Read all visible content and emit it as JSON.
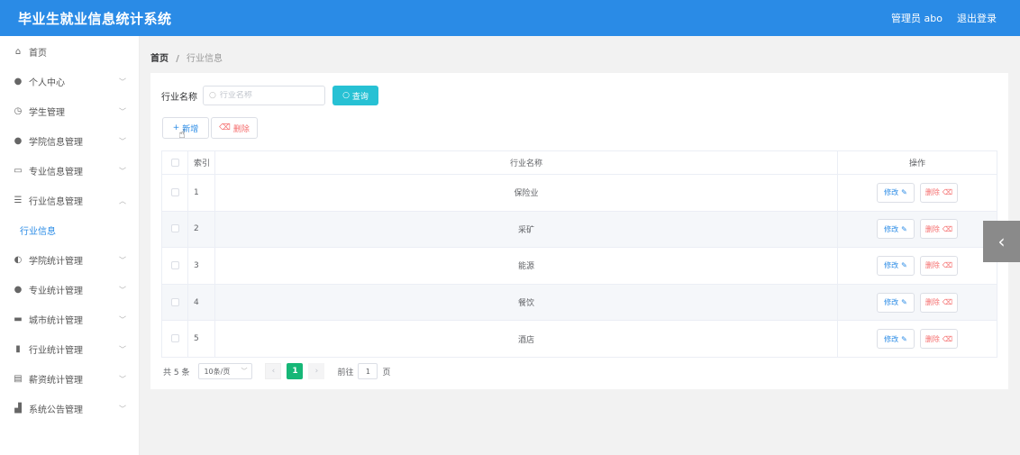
{
  "header": {
    "title": "毕业生就业信息统计系统",
    "user": "管理员 abo",
    "logout": "退出登录"
  },
  "sidebar": {
    "items": [
      {
        "label": "首页",
        "icon": "home-icon",
        "glyph": "⌂"
      },
      {
        "label": "个人中心",
        "icon": "user-icon",
        "glyph": "●"
      },
      {
        "label": "学生管理",
        "icon": "clock-icon",
        "glyph": "◷"
      },
      {
        "label": "学院信息管理",
        "icon": "location-icon",
        "glyph": "●"
      },
      {
        "label": "专业信息管理",
        "icon": "message-icon",
        "glyph": "▭"
      },
      {
        "label": "行业信息管理",
        "icon": "list-icon",
        "glyph": "☰"
      },
      {
        "label": "学院统计管理",
        "icon": "info-icon",
        "glyph": "◐"
      },
      {
        "label": "专业统计管理",
        "icon": "user-icon",
        "glyph": "●"
      },
      {
        "label": "城市统计管理",
        "icon": "monitor-icon",
        "glyph": "▬"
      },
      {
        "label": "行业统计管理",
        "icon": "bar-chart-icon",
        "glyph": "▮"
      },
      {
        "label": "薪资统计管理",
        "icon": "document-icon",
        "glyph": "▤"
      },
      {
        "label": "系统公告管理",
        "icon": "chart-icon",
        "glyph": "▟"
      }
    ],
    "sub_item": "行业信息"
  },
  "breadcrumb": {
    "home": "首页",
    "sep": "/",
    "current": "行业信息"
  },
  "search": {
    "label": "行业名称",
    "placeholder": "行业名称",
    "query_button": "查询"
  },
  "actions": {
    "add": "新增",
    "delete": "删除"
  },
  "table": {
    "headers": {
      "index": "索引",
      "name": "行业名称",
      "ops": "操作"
    },
    "rows": [
      {
        "index": "1",
        "name": "保险业"
      },
      {
        "index": "2",
        "name": "采矿"
      },
      {
        "index": "3",
        "name": "能源"
      },
      {
        "index": "4",
        "name": "餐饮"
      },
      {
        "index": "5",
        "name": "酒店"
      }
    ],
    "edit_label": "修改",
    "delete_label": "删除"
  },
  "pagination": {
    "total": "共 5 条",
    "page_size": "10条/页",
    "current_page": "1",
    "goto_label": "前往",
    "goto_value": "1",
    "page_suffix": "页"
  },
  "colors": {
    "header": "#2a8be6",
    "query": "#27c1d4",
    "page_active": "#16b777",
    "danger": "#f56c6c"
  }
}
